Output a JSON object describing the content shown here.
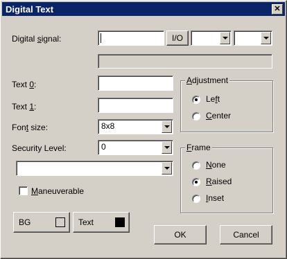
{
  "window": {
    "title": "Digital Text",
    "close_glyph": "✕"
  },
  "digital_signal": {
    "label_pre": "Digital ",
    "label_u": "s",
    "label_post": "ignal:",
    "value": "",
    "io_button": "I/O",
    "combo1": "",
    "combo2": "",
    "secondary": ""
  },
  "text0": {
    "label_pre": "Text ",
    "label_u": "0",
    "label_post": ":",
    "value": ""
  },
  "text1": {
    "label_pre": "Text ",
    "label_u": "1",
    "label_post": ":",
    "value": ""
  },
  "font_size": {
    "label_pre": "Fon",
    "label_u": "t",
    "label_post": " size:",
    "value": "8x8"
  },
  "security": {
    "label": "Security Level:",
    "value": "0"
  },
  "extra_combo": {
    "value": ""
  },
  "maneuverable": {
    "label_u": "M",
    "label_post": "aneuverable",
    "checked": false
  },
  "adjustment": {
    "title_u": "A",
    "title_post": "djustment",
    "options": [
      {
        "pre": "Le",
        "u": "f",
        "post": "t",
        "selected": true
      },
      {
        "pre": "",
        "u": "C",
        "post": "enter",
        "selected": false
      }
    ]
  },
  "frame": {
    "title_u": "F",
    "title_post": "rame",
    "options": [
      {
        "pre": "",
        "u": "N",
        "post": "one",
        "selected": false
      },
      {
        "pre": "",
        "u": "R",
        "post": "aised",
        "selected": true
      },
      {
        "pre": "",
        "u": "I",
        "post": "nset",
        "selected": false
      }
    ]
  },
  "colors": {
    "bg_label": "BG",
    "bg_color": "#d4d0c8",
    "text_label": "Text",
    "text_color": "#000000"
  },
  "buttons": {
    "ok": "OK",
    "cancel": "Cancel"
  }
}
